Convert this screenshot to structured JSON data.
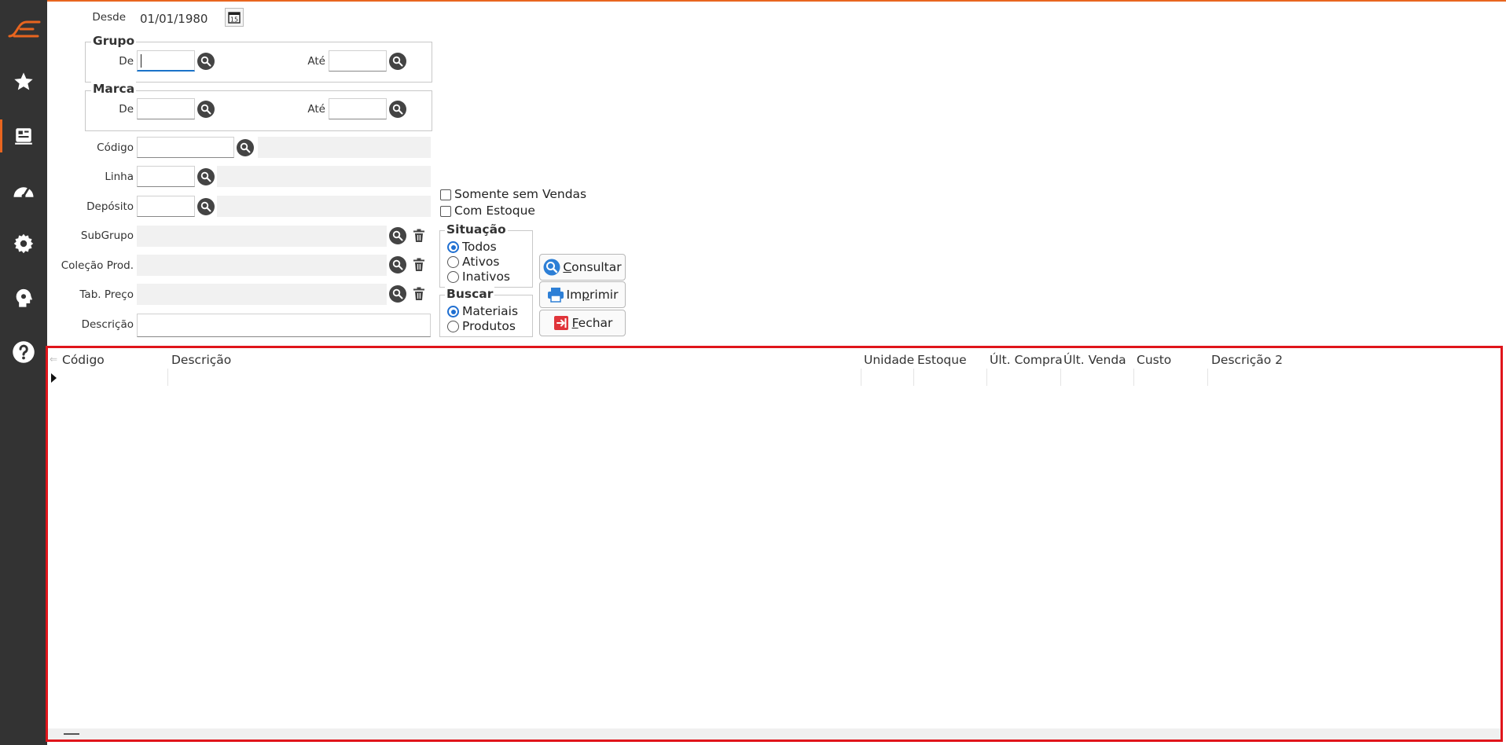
{
  "filters": {
    "desde_label": "Desde",
    "desde_value": "01/01/1980",
    "grupo": {
      "title": "Grupo",
      "de_label": "De",
      "ate_label": "Até"
    },
    "marca": {
      "title": "Marca",
      "de_label": "De",
      "ate_label": "Até"
    },
    "codigo_label": "Código",
    "linha_label": "Linha",
    "deposito_label": "Depósito",
    "subgrupo_label": "SubGrupo",
    "colecao_label": "Coleção Prod.",
    "tabpreco_label": "Tab. Preço",
    "descricao_label": "Descrição"
  },
  "options": {
    "somente_sem_vendas": "Somente sem Vendas",
    "com_estoque": "Com Estoque",
    "situacao": {
      "title": "Situação",
      "items": [
        "Todos",
        "Ativos",
        "Inativos"
      ],
      "selected": "Todos"
    },
    "buscar": {
      "title": "Buscar",
      "items": [
        "Materiais",
        "Produtos"
      ],
      "selected": "Materiais"
    }
  },
  "buttons": {
    "consultar": {
      "first": "C",
      "rest": "onsultar"
    },
    "imprimir": {
      "first": "Im",
      "mid": "p",
      "rest": "rimir"
    },
    "fechar": {
      "first": "F",
      "rest": "echar"
    }
  },
  "grid": {
    "columns": [
      "Código",
      "Descrição",
      "Unidade",
      "Estoque",
      "Últ. Compra",
      "Últ. Venda",
      "Custo",
      "Descrição 2"
    ]
  },
  "colors": {
    "accent": "#e8651f",
    "selection_border": "#e0151b",
    "radio": "#1f6fd1"
  }
}
